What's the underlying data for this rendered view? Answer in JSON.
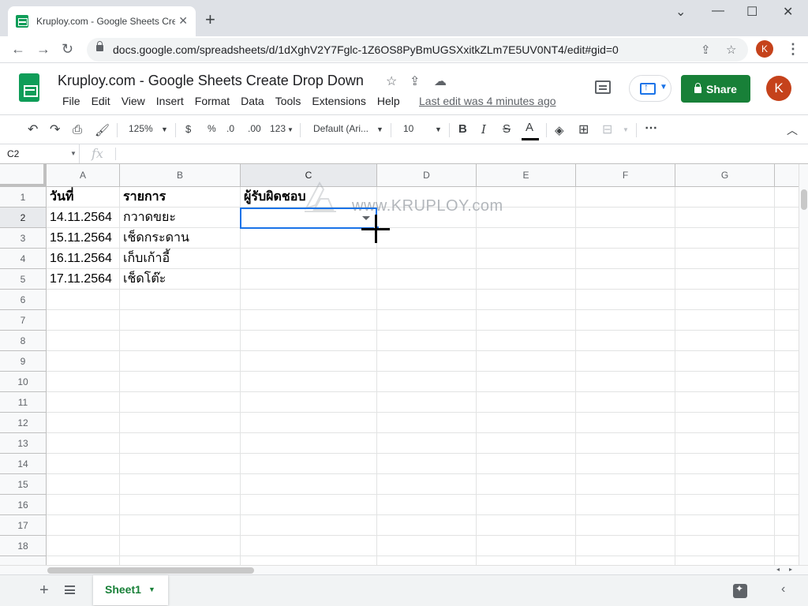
{
  "browser": {
    "tab_title": "Kruploy.com - Google Sheets Create Drop Down",
    "url": "docs.google.com/spreadsheets/d/1dXghV2Y7Fglc-1Z6OS8PyBmUGSXxitkZLm7E5UV0NT4/edit#gid=0",
    "profile_initial": "K"
  },
  "doc": {
    "title": "Kruploy.com - Google Sheets Create Drop Down",
    "menus": [
      "File",
      "Edit",
      "View",
      "Insert",
      "Format",
      "Data",
      "Tools",
      "Extensions",
      "Help"
    ],
    "last_edit": "Last edit was 4 minutes ago",
    "share_label": "Share",
    "account_initial": "K"
  },
  "toolbar": {
    "zoom": "125%",
    "currency": "$",
    "percent": "%",
    "dec_decrease": ".0",
    "dec_increase": ".00",
    "more_formats": "123",
    "font": "Default (Ari...",
    "font_size": "10",
    "bold": "B",
    "italic": "I",
    "strike": "S",
    "text_color": "A"
  },
  "formula_bar": {
    "cell_ref": "C2",
    "fx": "fx",
    "value": ""
  },
  "grid": {
    "columns": [
      "A",
      "B",
      "C",
      "D",
      "E",
      "F",
      "G"
    ],
    "rows": [
      "1",
      "2",
      "3",
      "4",
      "5",
      "6",
      "7",
      "8",
      "9",
      "10",
      "11",
      "12",
      "13",
      "14",
      "15",
      "16",
      "17",
      "18"
    ],
    "cells": {
      "A1": "วันที่",
      "B1": "รายการ",
      "C1": "ผู้รับผิดชอบ",
      "A2": "14.11.2564",
      "B2": "กวาดขยะ",
      "A3": "15.11.2564",
      "B3": "เช็ดกระดาน",
      "A4": "16.11.2564",
      "B4": "เก็บเก้าอี้",
      "A5": "17.11.2564",
      "B5": "เช็ดโต๊ะ"
    },
    "selected_cell": "C2",
    "watermark": "www.KRUPLOY.com"
  },
  "sheets": {
    "active": "Sheet1"
  },
  "colors": {
    "share_green": "#188038",
    "selection_blue": "#1a73e8",
    "avatar": "#c5421b"
  }
}
